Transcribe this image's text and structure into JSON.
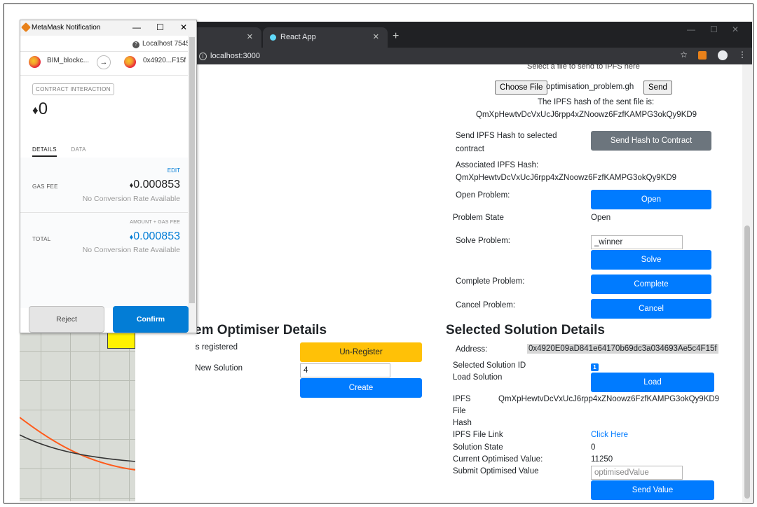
{
  "metamask": {
    "window_title": "MetaMask Notification",
    "host": "Localhost 7545",
    "from_account": "BIM_blockc...",
    "to_account": "0x4920...F15f",
    "interaction_label": "CONTRACT INTERACTION",
    "amount": "0",
    "tab_details": "DETAILS",
    "tab_data": "DATA",
    "edit_label": "EDIT",
    "gas_fee_label": "GAS FEE",
    "gas_fee_value": "0.000853",
    "gas_fee_note": "No Conversion Rate Available",
    "amount_gas_label": "AMOUNT + GAS FEE",
    "total_label": "TOTAL",
    "total_value": "0.000853",
    "total_note": "No Conversion Rate Available",
    "reject_label": "Reject",
    "confirm_label": "Confirm"
  },
  "browser": {
    "tab_title": "React App",
    "address": "localhost:3000"
  },
  "ipfs": {
    "select_text": "Select a file to send to IPFS here",
    "choose_file_label": "Choose File",
    "file_name": "optimisation_problem.gh",
    "send_label": "Send",
    "hash_caption": "The IPFS hash of the sent file is:",
    "hash_value": "QmXpHewtvDcVxUcJ6rpp4xZNoowz6FzfKAMPG3okQy9KD9"
  },
  "problem": {
    "send_hash_label_line1": "Send IPFS Hash to selected",
    "send_hash_label_line2": "contract",
    "send_hash_button": "Send Hash to Contract",
    "associated_label": "Associated IPFS Hash:",
    "associated_value": "QmXpHewtvDcVxUcJ6rpp4xZNoowz6FzfKAMPG3okQy9KD9",
    "open_label": "Open Problem:",
    "open_button": "Open",
    "state_label": "Problem State",
    "state_value": "Open",
    "solve_label": "Solve Problem:",
    "solve_input": "_winner",
    "solve_button": "Solve",
    "complete_label": "Complete Problem:",
    "complete_button": "Complete",
    "cancel_label": "Cancel Problem:",
    "cancel_button": "Cancel"
  },
  "optimiser": {
    "heading": "Problem Optimiser Details",
    "heading_visible": "em Optimiser Details",
    "registered_label": "Address is registered",
    "unregister_button": "Un-Register",
    "create_label": "Create a New Solution",
    "create_input": "4",
    "create_button": "Create"
  },
  "solution": {
    "heading": "Selected Solution Details",
    "address_label": "Address:",
    "address_value": "0x4920E09aD841e64170b69dc3a034693Ae5c4F15f",
    "selected_id_label": "Selected Solution ID",
    "selected_id_value": "1",
    "load_label": "Load Solution",
    "load_button": "Load",
    "ipfs_hash_label_1": "IPFS",
    "ipfs_hash_label_2": "File",
    "ipfs_hash_label_3": "Hash",
    "ipfs_hash_value": "QmXpHewtvDcVxUcJ6rpp4xZNoowz6FzfKAMPG3okQy9KD9",
    "file_link_label": "IPFS File Link",
    "file_link_value": "Click Here",
    "state_label": "Solution State",
    "state_value": "0",
    "current_value_label": "Current Optimised Value:",
    "current_value": "11250",
    "submit_label": "Submit Optimised Value",
    "submit_placeholder": "optimisedValue",
    "send_value_button": "Send Value"
  },
  "colors": {
    "primary": "#007bff",
    "secondary": "#6c757d",
    "warning": "#ffc107",
    "metamask_blue": "#037dd6"
  }
}
